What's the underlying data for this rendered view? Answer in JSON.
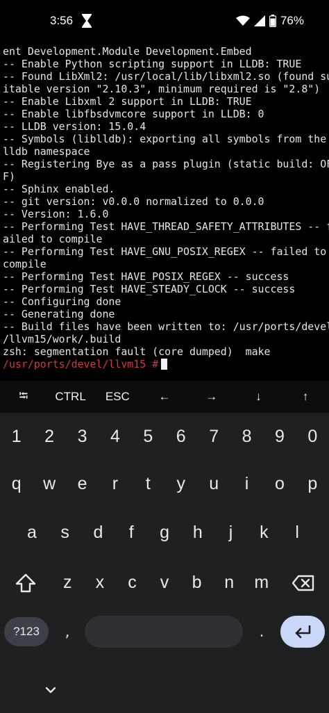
{
  "status_bar": {
    "time": "3:56",
    "battery_percent": "76%",
    "icons": [
      "hourglass-icon",
      "wifi-icon",
      "signal-icon",
      "battery-icon"
    ]
  },
  "terminal": {
    "lines": [
      "ent Development.Module Development.Embed",
      "-- Enable Python scripting support in LLDB: TRUE",
      "-- Found LibXml2: /usr/local/lib/libxml2.so (found su",
      "itable version \"2.10.3\", minimum required is \"2.8\")",
      "-- Enable Libxml 2 support in LLDB: TRUE",
      "-- Enable libfbsdvmcore support in LLDB: 0",
      "-- LLDB version: 15.0.4",
      "-- Symbols (liblldb): exporting all symbols from the",
      "lldb namespace",
      "-- Registering Bye as a pass plugin (static build: OF",
      "F)",
      "-- Sphinx enabled.",
      "-- git version: v0.0.0 normalized to 0.0.0",
      "-- Version: 1.6.0",
      "-- Performing Test HAVE_THREAD_SAFETY_ATTRIBUTES -- f",
      "ailed to compile",
      "-- Performing Test HAVE_GNU_POSIX_REGEX -- failed to",
      "compile",
      "-- Performing Test HAVE_POSIX_REGEX -- success",
      "-- Performing Test HAVE_STEADY_CLOCK -- success",
      "-- Configuring done",
      "-- Generating done",
      "-- Build files have been written to: /usr/ports/devel",
      "/llvm15/work/.build",
      "zsh: segmentation fault (core dumped)  make"
    ],
    "prompt": "/usr/ports/devel/llvm15 #",
    "prompt_color": "#d4373f"
  },
  "extra_keys": [
    "⭾",
    "CTRL",
    "ESC",
    "←",
    "→",
    "↓",
    "↑"
  ],
  "keyboard": {
    "row_numbers": [
      "1",
      "2",
      "3",
      "4",
      "5",
      "6",
      "7",
      "8",
      "9",
      "0"
    ],
    "row_top": [
      "q",
      "w",
      "e",
      "r",
      "t",
      "y",
      "u",
      "i",
      "o",
      "p"
    ],
    "row_middle": [
      "a",
      "s",
      "d",
      "f",
      "g",
      "h",
      "j",
      "k",
      "l"
    ],
    "row_bottom": [
      "z",
      "x",
      "c",
      "v",
      "b",
      "n",
      "m"
    ],
    "symbols_key": "?123",
    "comma": ",",
    "period": ".",
    "enter_color": "#c9d8f8"
  }
}
